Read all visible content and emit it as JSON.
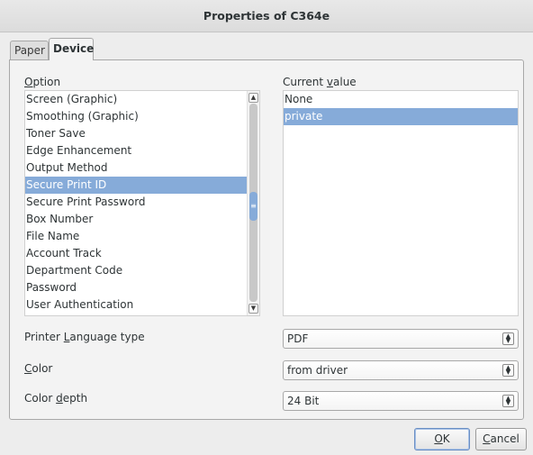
{
  "window": {
    "title": "Properties of C364e"
  },
  "tabs": [
    {
      "label": "Paper",
      "active": false
    },
    {
      "label": "Device",
      "active": true
    }
  ],
  "option_header": {
    "pre": "",
    "key": "O",
    "post": "ption"
  },
  "value_header": {
    "pre": "Current ",
    "key": "v",
    "post": "alue"
  },
  "options": [
    "Screen (Graphic)",
    "Smoothing (Graphic)",
    "Toner Save",
    "Edge Enhancement",
    "Output Method",
    "Secure Print ID",
    "Secure Print Password",
    "Box Number",
    "File Name",
    "Account Track",
    "Department Code",
    "Password",
    "User Authentication"
  ],
  "selected_option": "Secure Print ID",
  "values": [
    "None",
    "private"
  ],
  "selected_value": "private",
  "printer_language": {
    "label": {
      "pre": "Printer ",
      "key": "L",
      "post": "anguage type"
    },
    "value": "PDF"
  },
  "color": {
    "label": {
      "pre": "",
      "key": "C",
      "post": "olor"
    },
    "value": "from driver"
  },
  "color_depth": {
    "label": {
      "pre": "Color ",
      "key": "d",
      "post": "epth"
    },
    "value": "24 Bit"
  },
  "buttons": {
    "ok": {
      "pre": "",
      "key": "O",
      "post": "K"
    },
    "cancel": {
      "pre": "",
      "key": "C",
      "post": "ancel"
    }
  },
  "colors": {
    "selection": "#86abd9",
    "background": "#ededed",
    "panel": "#f3f3f3"
  }
}
